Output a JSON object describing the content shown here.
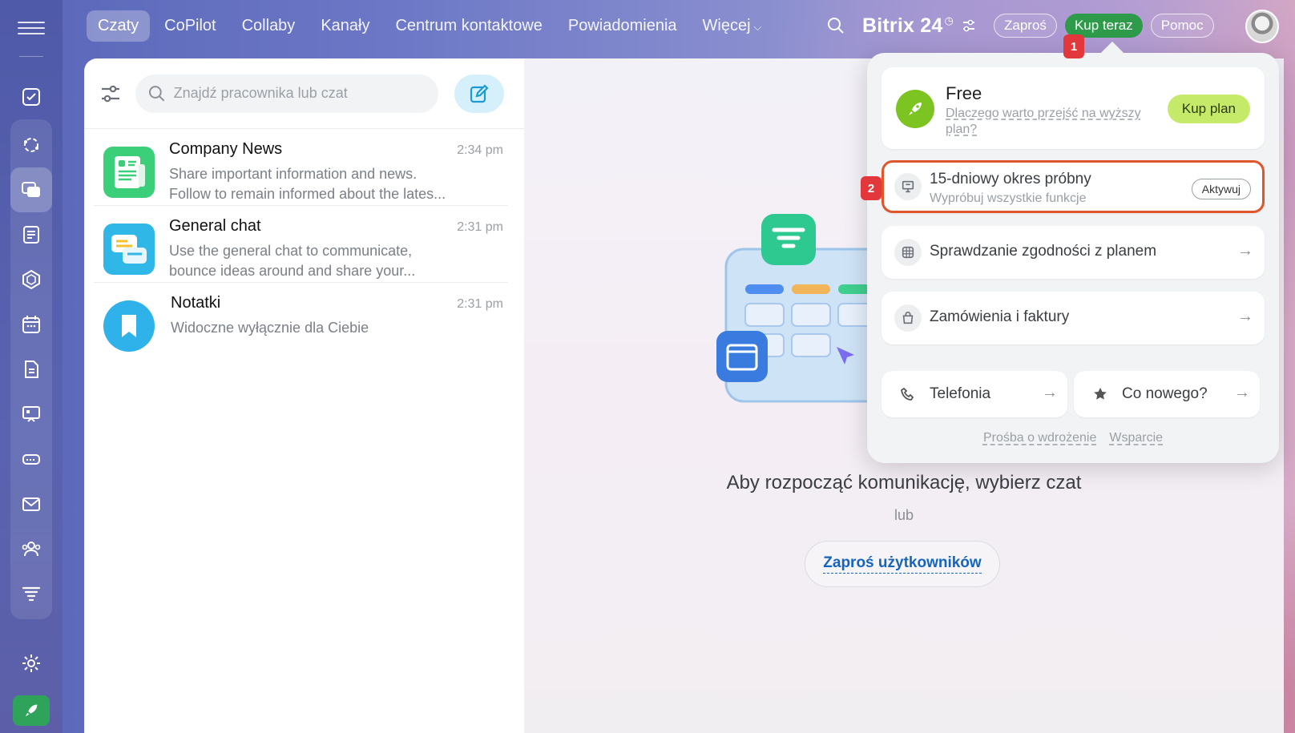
{
  "nav": {
    "tabs": [
      {
        "label": "Czaty",
        "active": true
      },
      {
        "label": "CoPilot"
      },
      {
        "label": "Collaby"
      },
      {
        "label": "Kanały"
      },
      {
        "label": "Centrum kontaktowe"
      },
      {
        "label": "Powiadomienia"
      },
      {
        "label": "Więcej"
      }
    ],
    "more_chevron": "⌵"
  },
  "header": {
    "brand": "Bitrix 24",
    "brand_icon": "clock-icon",
    "invite_label": "Zaproś",
    "buy_now_label": "Kup teraz",
    "help_label": "Pomoc"
  },
  "badges": {
    "one": "1",
    "two": "2"
  },
  "chat_list": {
    "search_placeholder": "Znajdź pracownika lub czat",
    "chats": [
      {
        "name": "Company News",
        "time": "2:34 pm",
        "line1": "Share important information and news.",
        "line2": "Follow to remain informed about the lates...",
        "icon": "news-icon",
        "color": "#3ccf7a"
      },
      {
        "name": "General chat",
        "time": "2:31 pm",
        "line1": "Use the general chat to communicate,",
        "line2": "bounce ideas around and share your...",
        "icon": "chat-bubbles-icon",
        "color": "#2fb7e8"
      },
      {
        "name": "Notatki",
        "time": "2:31 pm",
        "line1": "Widoczne wyłącznie dla Ciebie",
        "line2": "",
        "icon": "bookmark-icon",
        "color": "#2fb1ea"
      }
    ]
  },
  "main": {
    "empty_title": "Aby rozpocząć komunikację, wybierz czat",
    "or_text": "lub",
    "invite_users_label": "Zaproś użytkowników"
  },
  "popup": {
    "plan_name": "Free",
    "plan_subtitle": "Dlaczego warto przejść na wyższy plan?",
    "buy_plan_label": "Kup plan",
    "trial_title": "15-dniowy okres próbny",
    "trial_subtitle": "Wypróbuj wszystkie funkcje",
    "activate_label": "Aktywuj",
    "plan_check_label": "Sprawdzanie zgodności z planem",
    "orders_label": "Zamówienia i faktury",
    "telephony_label": "Telefonia",
    "whats_new_label": "Co nowego?",
    "link_implementation": "Prośba o wdrożenie",
    "link_support": "Wsparcie",
    "arrow": "→"
  },
  "colors": {
    "accent_green": "#2e9b4b",
    "highlight_red": "#e0552a",
    "badge_red": "#e3383b",
    "link_blue": "#1565c0"
  }
}
